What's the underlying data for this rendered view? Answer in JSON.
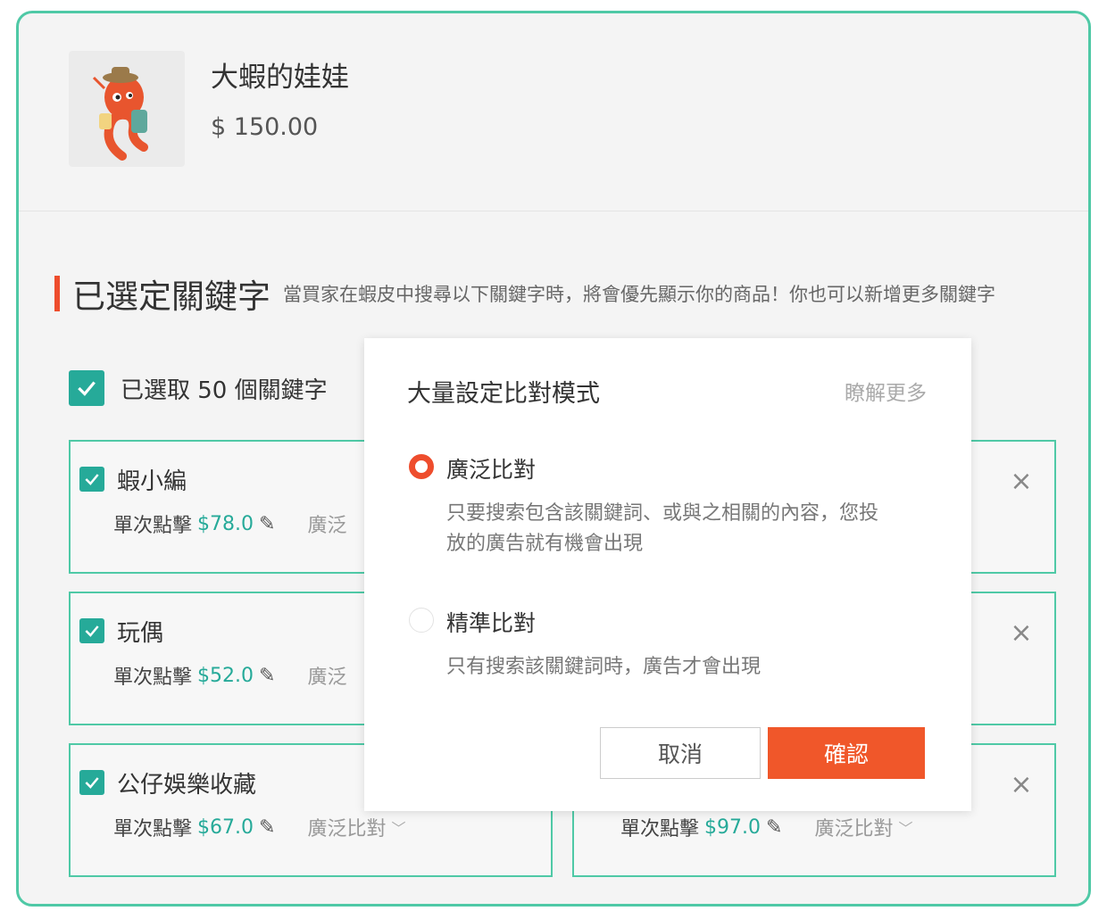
{
  "product": {
    "name": "大蝦的娃娃",
    "price": "$ 150.00",
    "image": "shrimp-mascot"
  },
  "keywords_section": {
    "title": "已選定關鍵字",
    "hint": "當買家在蝦皮中搜尋以下關鍵字時，將會優先顯示你的商品！你也可以新增更多關鍵字"
  },
  "select_all": {
    "label": "已選取 50 個關鍵字",
    "checked": true
  },
  "cards": [
    {
      "keyword": "蝦小編",
      "bid_label": "單次點擊",
      "bid": "$78.0",
      "match": "廣泛"
    },
    {
      "keyword": "玩偶",
      "bid_label": "單次點擊",
      "bid": "$52.0",
      "match": "廣泛"
    },
    {
      "keyword": "公仔娛樂收藏",
      "bid_label": "單次點擊",
      "bid": "$67.0",
      "match": "廣泛比對"
    },
    {
      "keyword": "",
      "bid_label": "單次點擊",
      "bid": "$97.0",
      "match": "廣泛比對"
    }
  ],
  "modal": {
    "title": "大量設定比對模式",
    "learn_more": "瞭解更多",
    "options": [
      {
        "label": "廣泛比對",
        "selected": true,
        "desc_line1": "只要搜索包含該關鍵詞、或與之相關的內容，您投",
        "desc_line2": "放的廣告就有機會出現"
      },
      {
        "label": "精準比對",
        "selected": false,
        "desc_line1": "只有搜索該關鍵詞時，廣告才會出現"
      }
    ],
    "cancel": "取消",
    "confirm": "確認"
  },
  "colors": {
    "accent_green": "#26aa99",
    "border_green": "#4fc9a6",
    "brand_orange": "#ee4d2d"
  }
}
